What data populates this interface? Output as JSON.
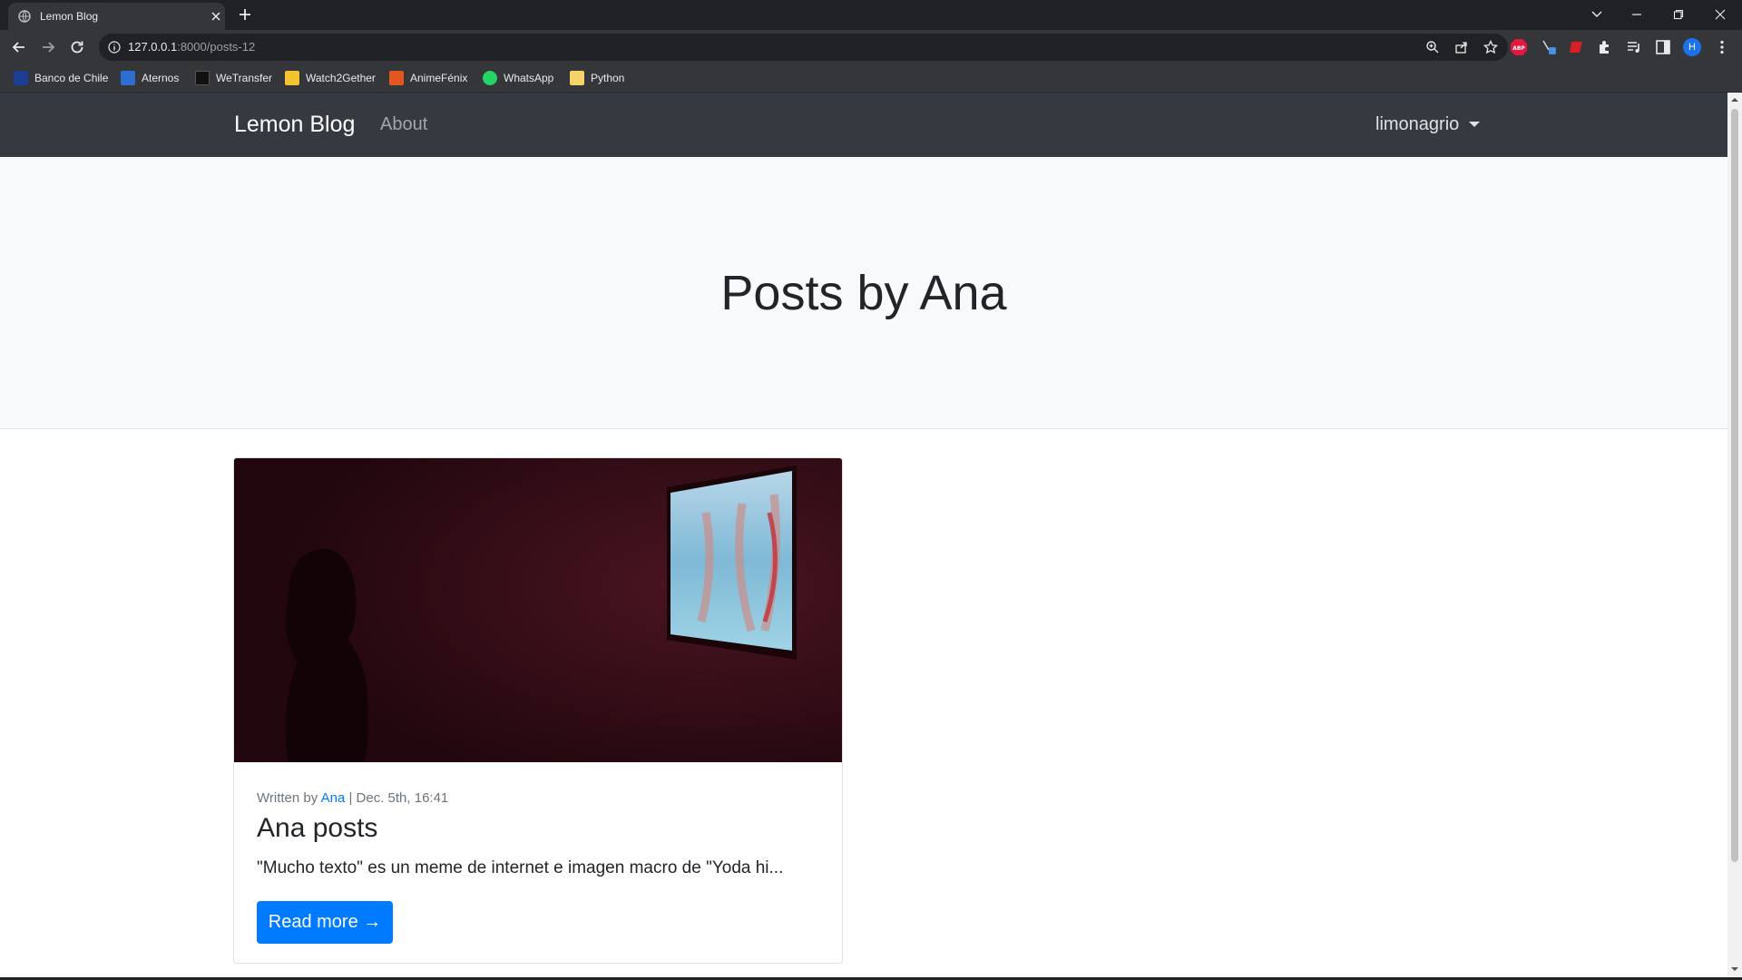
{
  "browser": {
    "tab": {
      "title": "Lemon Blog"
    },
    "address": {
      "host": "127.0.0.1",
      "path": ":8000/posts-12"
    },
    "bookmarks": [
      {
        "label": "Banco de Chile",
        "icon": "bank-icon",
        "color": "#1c3f94"
      },
      {
        "label": "Aternos",
        "icon": "aternos-icon",
        "color": "#2d6fd0"
      },
      {
        "label": "WeTransfer",
        "icon": "wetransfer-icon",
        "color": "#111111"
      },
      {
        "label": "Watch2Gether",
        "icon": "watch2gether-icon",
        "color": "#f4c430"
      },
      {
        "label": "AnimeFénix",
        "icon": "animefenix-icon",
        "color": "#e2571e"
      },
      {
        "label": "WhatsApp",
        "icon": "whatsapp-icon",
        "color": "#25d366"
      },
      {
        "label": "Python",
        "icon": "folder-icon",
        "color": "#f6d26b"
      }
    ],
    "profile_initial": "H"
  },
  "navbar": {
    "brand": "Lemon Blog",
    "about": "About",
    "user": "limonagrio"
  },
  "header": {
    "title": "Posts by Ana"
  },
  "post": {
    "written_by": "Written by",
    "author": "Ana",
    "date": "| Dec. 5th, 16:41",
    "title": "Ana posts",
    "excerpt": "\"Mucho texto\" es un meme de internet e imagen macro de \"Yoda hi...",
    "read_more": "Read more →"
  },
  "colors": {
    "navbar_bg": "#343a40",
    "primary": "#007bff",
    "jumbotron_bg": "#f8f9fa"
  }
}
